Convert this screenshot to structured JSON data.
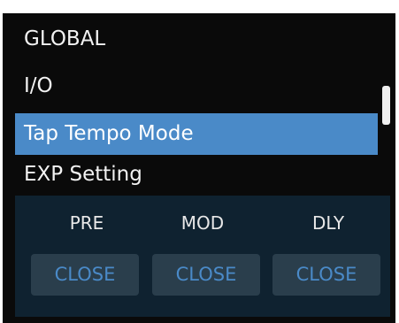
{
  "menu": {
    "items": [
      {
        "label": "GLOBAL"
      },
      {
        "label": "I/O"
      },
      {
        "label": "Tap Tempo Mode",
        "selected": true
      },
      {
        "label": "EXP Setting"
      }
    ]
  },
  "panel": {
    "columns": [
      {
        "label": "PRE",
        "button": "CLOSE"
      },
      {
        "label": "MOD",
        "button": "CLOSE"
      },
      {
        "label": "DLY",
        "button": "CLOSE"
      }
    ]
  },
  "colors": {
    "background": "#0a0a0a",
    "selected_highlight": "#4a8ac8",
    "panel_bg": "#0f2230",
    "button_bg": "#2a3e4c",
    "button_text": "#4a8ac8"
  }
}
